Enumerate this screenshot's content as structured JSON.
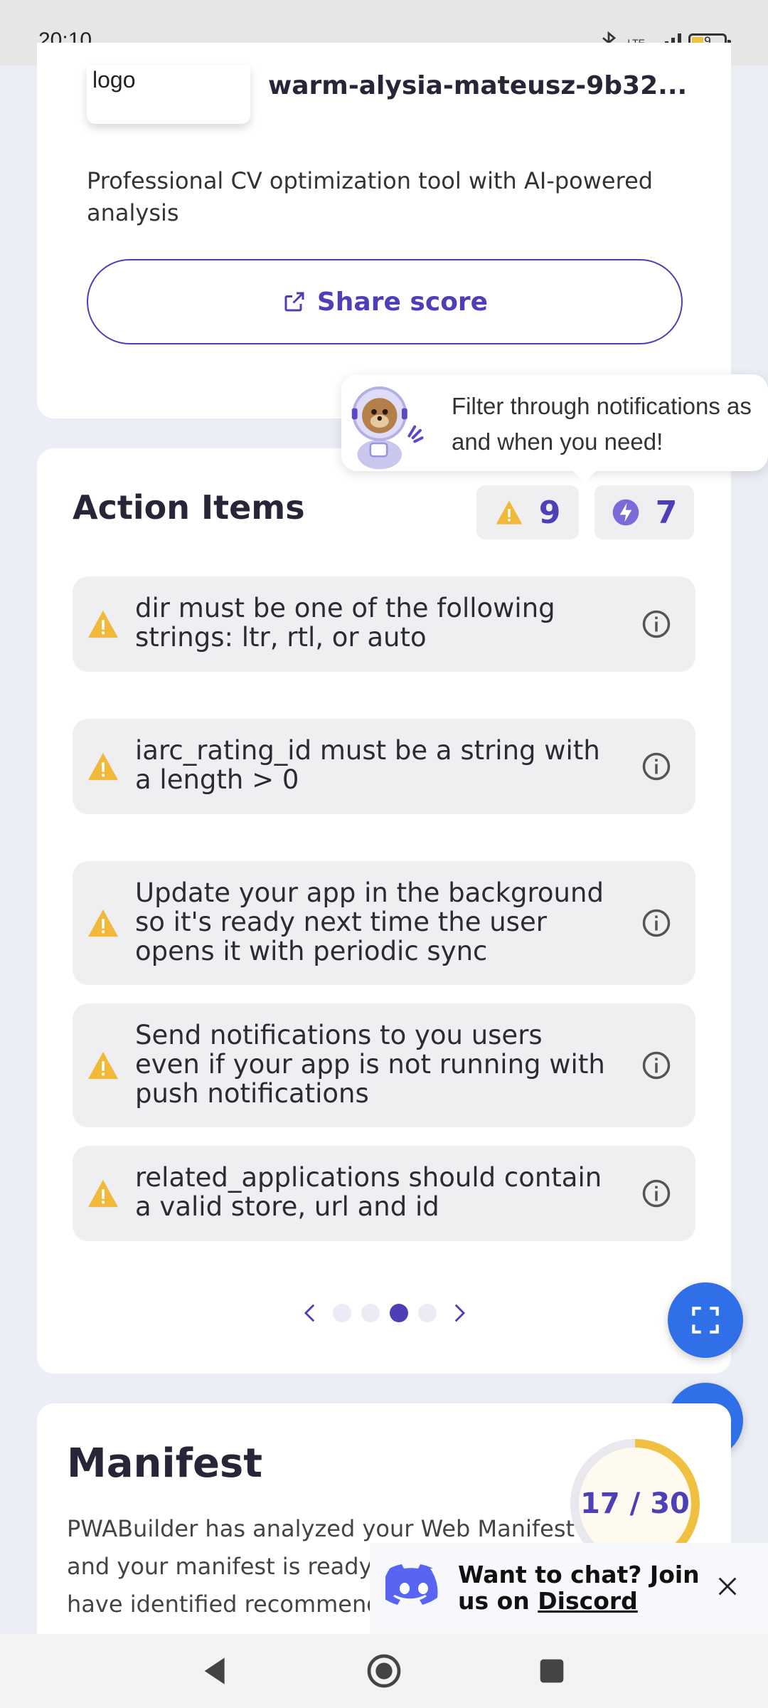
{
  "status_bar": {
    "time": "20:10",
    "network": "LTE",
    "battery": "9",
    "icons": [
      "bluetooth-icon",
      "signal-icon",
      "battery-icon"
    ]
  },
  "app_card": {
    "logo_label": "logo",
    "site_name": "warm-alysia-mateusz-9b32...",
    "description": "Professional CV optimization tool with AI-powered analysis",
    "share_button": "Share score"
  },
  "tooltip": {
    "text": "Filter through notifications as and when you need!"
  },
  "action_items": {
    "title": "Action Items",
    "warning_count": "9",
    "enhancement_count": "7",
    "items": [
      {
        "text": "dir must be one of the following strings: ltr, rtl, or auto"
      },
      {
        "text": "iarc_rating_id must be a string with a length > 0"
      },
      {
        "text": "Update your app in the background so it's ready next time the user opens it with periodic sync"
      },
      {
        "text": "Send notifications to you users even if your app is not running with push notifications"
      },
      {
        "text": "related_applications should contain a valid store, url and id"
      }
    ],
    "pager": {
      "pages": 4,
      "current": 3
    }
  },
  "manifest": {
    "title": "Manifest",
    "score": "17 / 30",
    "score_value": 17,
    "score_max": 30,
    "description": "PWABuilder has analyzed your Web Manifest and your manifest is ready f",
    "description_line3": "have identified recommende"
  },
  "discord": {
    "text_prefix": "Want to chat? Join us on ",
    "link": "Discord"
  },
  "colors": {
    "accent": "#4f3fb6",
    "fab": "#2f6fe7",
    "warning": "#f0b93a",
    "score_ring": "#f0c040"
  }
}
